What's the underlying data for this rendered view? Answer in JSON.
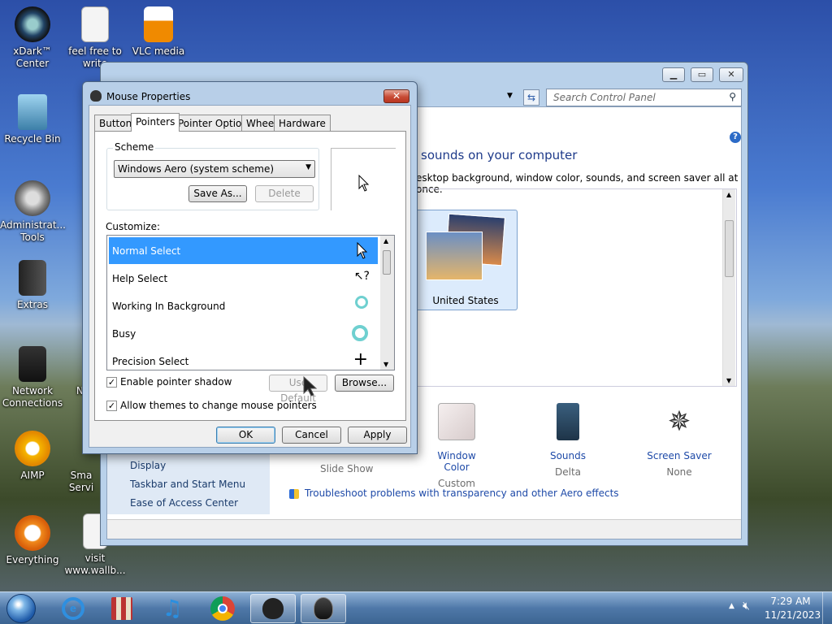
{
  "desktop": {
    "icons": [
      {
        "label": "xDark™ Center",
        "icon": "xdark-icon"
      },
      {
        "label": "Recycle Bin",
        "icon": "recycle-bin-icon"
      },
      {
        "label": "Administrat... Tools",
        "icon": "admin-tools-icon"
      },
      {
        "label": "Extras",
        "icon": "folder-icon"
      },
      {
        "label": "Network Connections",
        "icon": "network-icon"
      },
      {
        "label": "AIMP",
        "icon": "aimp-icon"
      },
      {
        "label": "Everything",
        "icon": "everything-icon"
      },
      {
        "label": "feel free to write",
        "icon": "document-icon"
      },
      {
        "label": "VLC media",
        "icon": "vlc-icon"
      },
      {
        "label": "visit www.wallb...",
        "icon": "document-icon"
      },
      {
        "label": "No",
        "icon": "document-icon"
      },
      {
        "label": "Sma Servi",
        "icon": "document-icon"
      }
    ]
  },
  "control_panel": {
    "search_placeholder": "Search Control Panel",
    "heading": "sounds on your computer",
    "subtext": "esktop background, window color, sounds, and screen saver all at once.",
    "theme_label": "United States",
    "bottom_items": [
      {
        "title": "",
        "sub": "Slide Show"
      },
      {
        "title": "Window Color",
        "sub": "Custom"
      },
      {
        "title": "Sounds",
        "sub": "Delta"
      },
      {
        "title": "Screen Saver",
        "sub": "None"
      }
    ],
    "sidebar_links": [
      "Display",
      "Taskbar and Start Menu",
      "Ease of Access Center"
    ],
    "troubleshoot_link": "Troubleshoot problems with transparency and other Aero effects"
  },
  "dialog": {
    "title": "Mouse Properties",
    "close": "✕",
    "tabs": [
      "Buttons",
      "Pointers",
      "Pointer Options",
      "Wheel",
      "Hardware"
    ],
    "active_tab": "Pointers",
    "scheme_label": "Scheme",
    "scheme_value": "Windows Aero (system scheme)",
    "save_as": "Save As...",
    "delete": "Delete",
    "customize_label": "Customize:",
    "pointers": [
      {
        "name": "Normal Select",
        "selected": true
      },
      {
        "name": "Help Select",
        "selected": false
      },
      {
        "name": "Working In Background",
        "selected": false
      },
      {
        "name": "Busy",
        "selected": false
      },
      {
        "name": "Precision Select",
        "selected": false
      }
    ],
    "enable_shadow": "Enable pointer shadow",
    "enable_shadow_checked": true,
    "use_default": "Use Default",
    "browse": "Browse...",
    "allow_themes": "Allow themes to change mouse pointers",
    "allow_themes_checked": true,
    "ok": "OK",
    "cancel": "Cancel",
    "apply": "Apply"
  },
  "taskbar": {
    "time": "7:29 AM",
    "date": "11/21/2023",
    "apps": [
      "start-orb-icon",
      "ie-icon",
      "archive-icon",
      "music-icon",
      "chrome-icon",
      "mouse-dialog-icon",
      "mouse-icon"
    ]
  },
  "colors": {
    "accent": "#3399ff",
    "link": "#1e4aa8",
    "close": "#c74b35"
  }
}
